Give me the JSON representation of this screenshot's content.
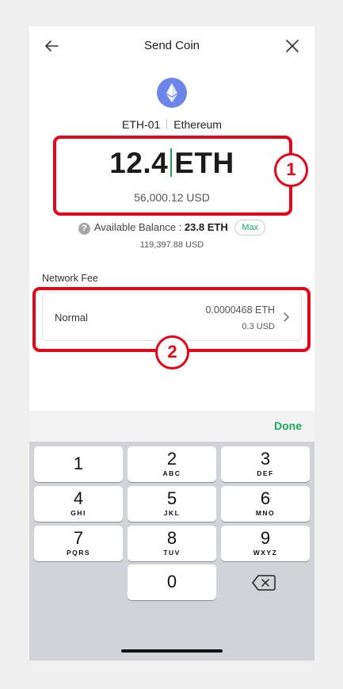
{
  "header": {
    "title": "Send Coin",
    "back_icon": "arrow-left-icon",
    "close_icon": "close-icon"
  },
  "coin": {
    "logo_icon": "ethereum-icon",
    "logo_color": "#6b85e8",
    "account": "ETH-01",
    "network": "Ethereum"
  },
  "amount": {
    "value": "12.4",
    "unit": "ETH",
    "usd": "56,000.12 USD"
  },
  "balance": {
    "label": "Available Balance :",
    "value": "23.8 ETH",
    "max_label": "Max",
    "usd": "119,397.88 USD"
  },
  "fee": {
    "label": "Network Fee",
    "type": "Normal",
    "eth": "0.0000468 ETH",
    "usd": "0.3 USD"
  },
  "annotations": {
    "box1": "1",
    "box2": "2",
    "color": "#e3071b"
  },
  "keyboard": {
    "done_label": "Done",
    "keys": [
      {
        "num": "1",
        "letters": ""
      },
      {
        "num": "2",
        "letters": "ABC"
      },
      {
        "num": "3",
        "letters": "DEF"
      },
      {
        "num": "4",
        "letters": "GHI"
      },
      {
        "num": "5",
        "letters": "JKL"
      },
      {
        "num": "6",
        "letters": "MNO"
      },
      {
        "num": "7",
        "letters": "PQRS"
      },
      {
        "num": "8",
        "letters": "TUV"
      },
      {
        "num": "9",
        "letters": "WXYZ"
      },
      {
        "num": "0",
        "letters": ""
      }
    ],
    "delete_icon": "backspace-icon"
  },
  "colors": {
    "accent": "#1aa75f",
    "annotation": "#e3071b"
  }
}
